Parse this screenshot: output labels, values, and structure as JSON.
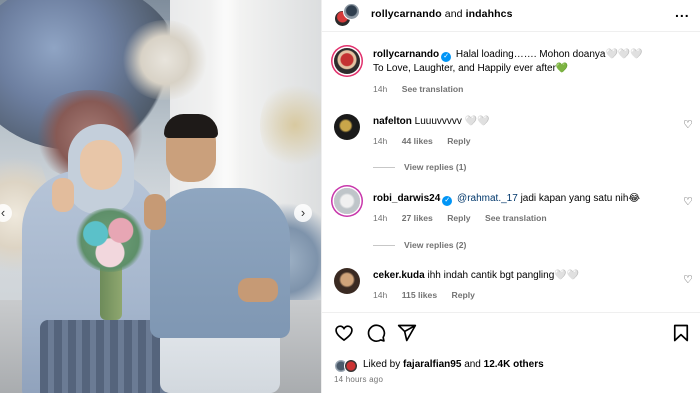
{
  "header": {
    "user1": "rollycarnando",
    "joiner": "and",
    "user2": "indahhcs",
    "more_label": "..."
  },
  "caption": {
    "username": "rollycarnando",
    "line1": "Halal loading……. Mohon doanya🤍🤍🤍",
    "line2": "To Love, Laughter, and Happily ever after💚",
    "time": "14h",
    "see_translation": "See translation"
  },
  "comments": [
    {
      "username": "nafelton",
      "text": "Luuuvvvvv 🤍🤍",
      "time": "14h",
      "likes": "44 likes",
      "reply": "Reply",
      "view_replies": "View replies (1)"
    },
    {
      "username": "robi_darwis24",
      "mention": "@rahmat._17",
      "text": " jadi kapan yang satu nih😂",
      "time": "14h",
      "likes": "27 likes",
      "reply": "Reply",
      "see_translation": "See translation",
      "view_replies": "View replies (2)"
    },
    {
      "username": "ceker.kuda",
      "text": "ihh indah cantik bgt pangling🤍🤍",
      "time": "14h",
      "likes": "115 likes",
      "reply": "Reply"
    }
  ],
  "likes": {
    "prefix": "Liked by",
    "user": "fajaralfian95",
    "middle": "and",
    "others": "12.4K others"
  },
  "time_ago": "14 hours ago",
  "icons": {
    "heart": "heart-icon",
    "comment": "comment-icon",
    "share": "share-icon",
    "save": "bookmark-icon",
    "verified": "verified-badge-icon"
  },
  "colors": {
    "verified": "#0095f6",
    "muted": "#737373",
    "mention": "#00376b"
  }
}
